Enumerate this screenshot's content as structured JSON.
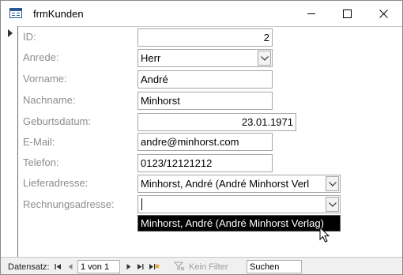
{
  "window": {
    "title": "frmKunden",
    "icon": "form-icon"
  },
  "fields": {
    "id": {
      "label": "ID:",
      "value": "2"
    },
    "anrede": {
      "label": "Anrede:",
      "value": "Herr"
    },
    "vorname": {
      "label": "Vorname:",
      "value": "André"
    },
    "nachname": {
      "label": "Nachname:",
      "value": "Minhorst"
    },
    "geburtsdatum": {
      "label": "Geburtsdatum:",
      "value": "23.01.1971"
    },
    "email": {
      "label": "E-Mail:",
      "value": "andre@minhorst.com"
    },
    "telefon": {
      "label": "Telefon:",
      "value": "0123/12121212"
    },
    "lieferadresse": {
      "label": "Lieferadresse:",
      "value": "Minhorst, André (André Minhorst Verl"
    },
    "rechnungsadresse": {
      "label": "Rechnungsadresse:",
      "value": ""
    }
  },
  "dropdown": {
    "items": [
      "Minhorst, André (André Minhorst Verlag)"
    ]
  },
  "navigation": {
    "label": "Datensatz:",
    "record_position": "1 von 1",
    "filter_label": "Kein Filter",
    "search_label": "Suchen"
  }
}
